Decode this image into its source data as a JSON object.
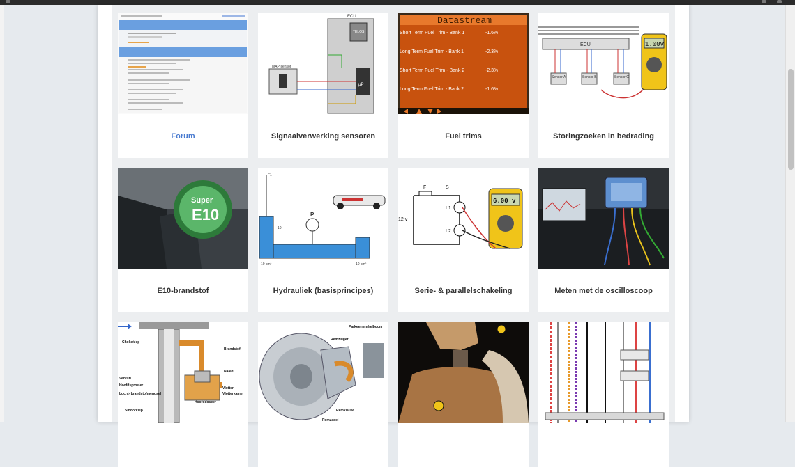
{
  "cards": [
    {
      "id": "forum",
      "title": "Forum",
      "link": true,
      "thumb": "forum-list"
    },
    {
      "id": "signaal",
      "title": "Signaalverwerking sensoren",
      "thumb": "ecu-diagram"
    },
    {
      "id": "fueltrims",
      "title": "Fuel trims",
      "thumb": "datastream"
    },
    {
      "id": "storing",
      "title": "Storingzoeken in bedrading",
      "thumb": "wiring-multimeter"
    },
    {
      "id": "e10",
      "title": "E10-brandstof",
      "thumb": "fuel-nozzle"
    },
    {
      "id": "hydro",
      "title": "Hydrauliek (basisprincipes)",
      "thumb": "hydraulic-lift"
    },
    {
      "id": "serie",
      "title": "Serie- & parallelschakeling",
      "thumb": "circuit-multimeter"
    },
    {
      "id": "osc",
      "title": "Meten met de oscilloscoop",
      "thumb": "oscilloscope-engine"
    },
    {
      "id": "carb",
      "title": "",
      "thumb": "carburetor"
    },
    {
      "id": "rem",
      "title": "",
      "thumb": "brake-caliper"
    },
    {
      "id": "dummy",
      "title": "",
      "thumb": "crash-dummy"
    },
    {
      "id": "schema",
      "title": "",
      "thumb": "wiring-schematic"
    }
  ],
  "thumb_text": {
    "ecu": "ECU",
    "telos": "TELOS",
    "map_sensor": "MAP-sensor",
    "up": "µP",
    "datastream_title": "Datastream",
    "fuel_rows": [
      {
        "label": "Short Term Fuel Trim - Bank 1",
        "value": "-1.6%"
      },
      {
        "label": "Long Term Fuel Trim - Bank 1",
        "value": "-2.3%"
      },
      {
        "label": "Short Term Fuel Trim - Bank 2",
        "value": "-2.3%"
      },
      {
        "label": "Long Term Fuel Trim - Bank 2",
        "value": "-1.6%"
      }
    ],
    "meter_1": "1.00v",
    "sensors": [
      "Sensor A",
      "Sensor B",
      "Sensor C"
    ],
    "super": "Super",
    "e10": "E10",
    "meter_2": "6.00 v",
    "circuit_labels": {
      "f": "F",
      "s": "S",
      "l1": "L1",
      "l2": "L2",
      "v": "12 v"
    },
    "hydro_labels": {
      "p": "P",
      "f1": "F1",
      "a1": "10 cm²",
      "a2": "10 cm²",
      "h": "10"
    },
    "carb_labels": [
      "Chokeklep",
      "Brandstof",
      "Naald",
      "Venturi",
      "Hoofdsproeier",
      "Lucht-\nbrandstofmengsel",
      "Vlotter",
      "Vlotterkamer",
      "Hoofddoseer",
      "Smoorklep"
    ],
    "brake_labels": [
      "Parkeerremhelboom",
      "Remzuiger",
      "Remklauw",
      "Remzadel"
    ]
  }
}
